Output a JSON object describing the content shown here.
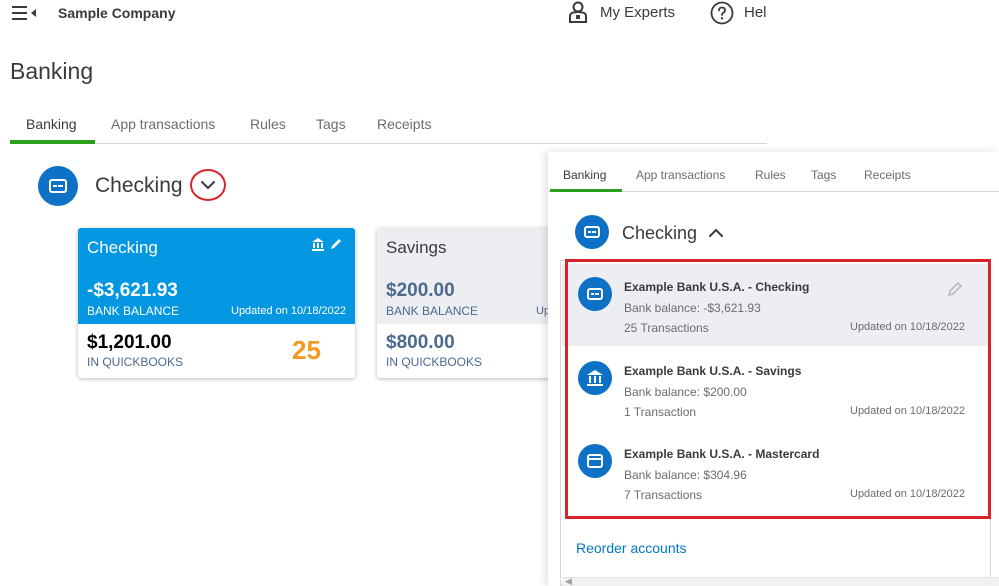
{
  "topbar": {
    "company": "Sample Company",
    "experts_label": "My Experts",
    "help_label": "Hel"
  },
  "page": {
    "title": "Banking"
  },
  "tabs": [
    {
      "label": "Banking",
      "active": true
    },
    {
      "label": "App transactions"
    },
    {
      "label": "Rules"
    },
    {
      "label": "Tags"
    },
    {
      "label": "Receipts"
    }
  ],
  "account": {
    "name": "Checking"
  },
  "cards": [
    {
      "title": "Checking",
      "bank_balance": "-$3,621.93",
      "bank_balance_label": "BANK BALANCE",
      "updated": "Updated on 10/18/2022",
      "qb_balance": "$1,201.00",
      "qb_label": "IN QUICKBOOKS",
      "count": "25"
    },
    {
      "title": "Savings",
      "bank_balance": "$200.00",
      "bank_balance_label": "BANK BALANCE",
      "updated": "Up",
      "qb_balance": "$800.00",
      "qb_label": "IN QUICKBOOKS"
    }
  ],
  "overlay": {
    "tabs": [
      {
        "label": "Banking",
        "active": true
      },
      {
        "label": "App transactions"
      },
      {
        "label": "Rules"
      },
      {
        "label": "Tags"
      },
      {
        "label": "Receipts"
      }
    ],
    "account_name": "Checking",
    "items": [
      {
        "name": "Example Bank U.S.A. - Checking",
        "balance": "Bank balance:  -$3,621.93",
        "transactions": "25 Transactions",
        "updated": "Updated on 10/18/2022",
        "icon": "bank-card-icon",
        "selected": true
      },
      {
        "name": "Example Bank U.S.A. - Savings",
        "balance": "Bank balance:  $200.00",
        "transactions": "1 Transaction",
        "updated": "Updated on 10/18/2022",
        "icon": "bank-building-icon"
      },
      {
        "name": "Example Bank U.S.A. - Mastercard",
        "balance": "Bank balance:  $304.96",
        "transactions": "7 Transactions",
        "updated": "Updated on 10/18/2022",
        "icon": "credit-card-icon"
      }
    ],
    "reorder_label": "Reorder accounts"
  },
  "colors": {
    "accent_blue": "#0397e1",
    "icon_blue": "#0d72c6",
    "tab_green": "#2ca01c",
    "highlight_red": "#d9232a",
    "count_orange": "#f49a23",
    "link_blue": "#0077c5"
  },
  "icons": {
    "menu": "hamburger-menu-icon",
    "experts": "experts-person-icon",
    "help": "help-question-icon",
    "dropdown": "chevron-down-icon",
    "collapse": "chevron-up-icon",
    "bank": "bank-icon",
    "edit": "pencil-icon"
  }
}
